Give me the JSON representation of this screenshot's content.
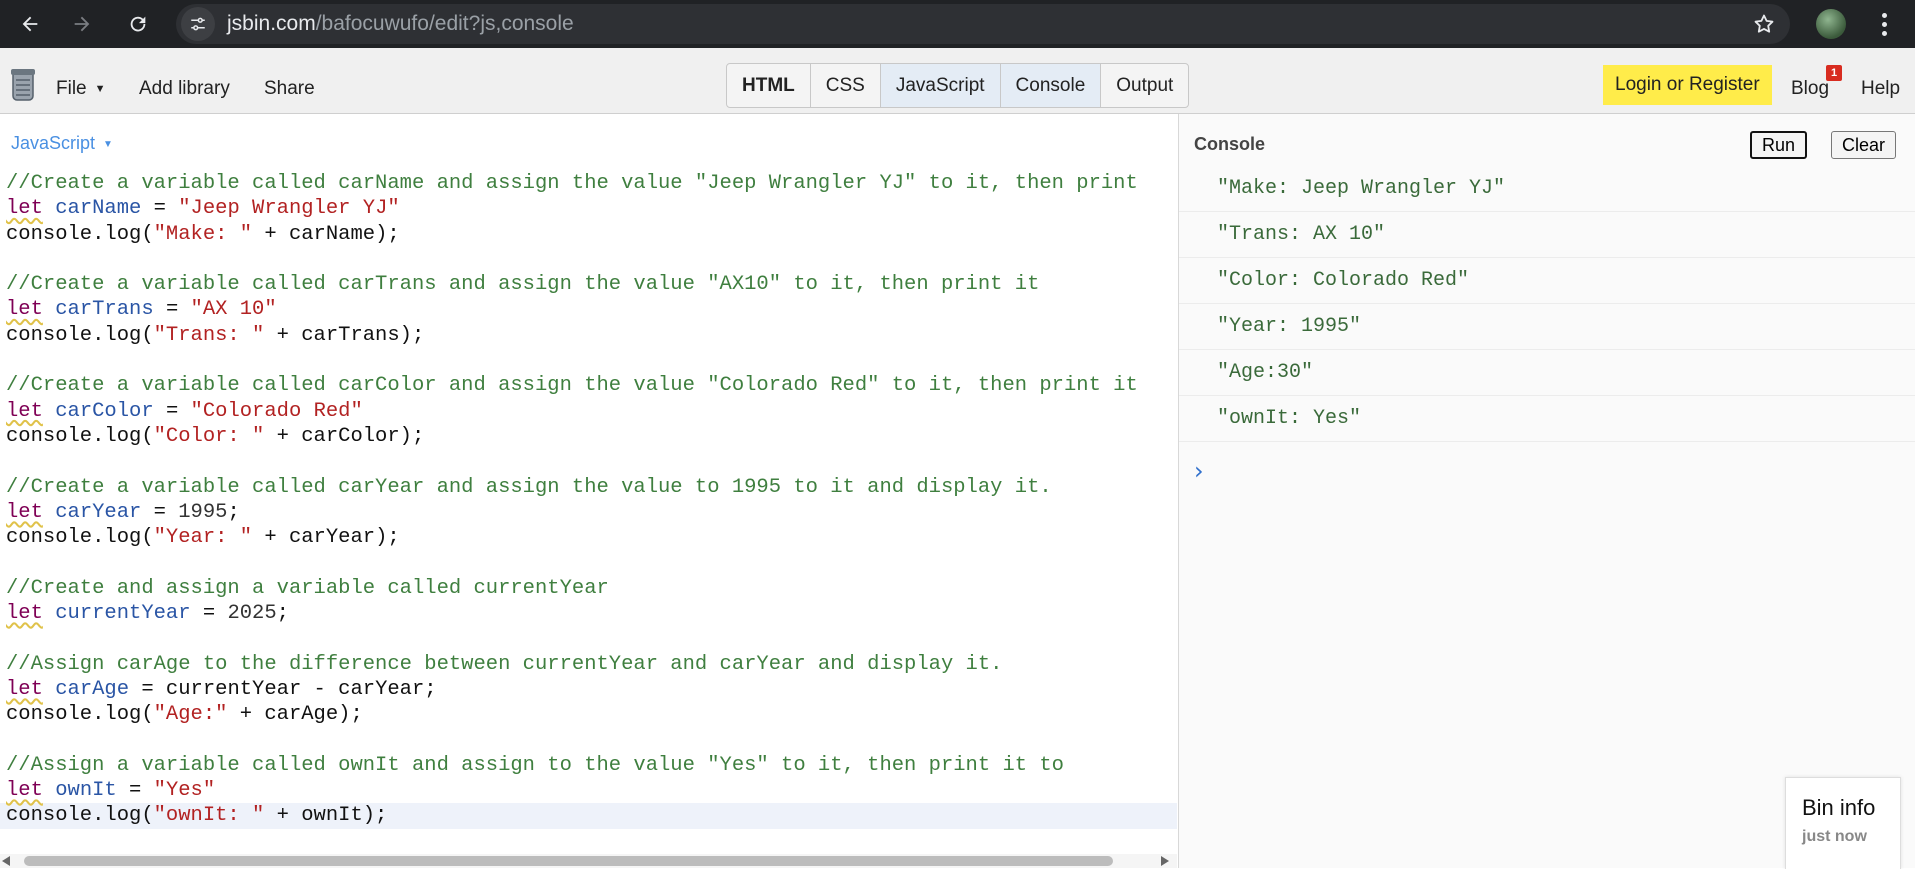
{
  "browser": {
    "url_host": "jsbin.com",
    "url_path": "/bafocuwufo/edit?js,console"
  },
  "toolbar": {
    "file_label": "File",
    "add_library_label": "Add library",
    "share_label": "Share",
    "panel_tabs": [
      {
        "label": "HTML",
        "active": false,
        "bold": true
      },
      {
        "label": "CSS",
        "active": false,
        "bold": false
      },
      {
        "label": "JavaScript",
        "active": true,
        "bold": false
      },
      {
        "label": "Console",
        "active": true,
        "bold": false
      },
      {
        "label": "Output",
        "active": false,
        "bold": false
      }
    ],
    "login_label": "Login or Register",
    "blog_label": "Blog",
    "blog_badge": "1",
    "help_label": "Help"
  },
  "editor": {
    "panel_label": "JavaScript",
    "lines": [
      [
        {
          "t": "c",
          "v": "//Create a variable called carName and assign the value \"Jeep Wrangler YJ\" to it, then print"
        }
      ],
      [
        {
          "t": "k",
          "v": "let"
        },
        {
          "t": "p",
          "v": " "
        },
        {
          "t": "v",
          "v": "carName"
        },
        {
          "t": "p",
          "v": " = "
        },
        {
          "t": "s",
          "v": "\"Jeep Wrangler YJ\""
        }
      ],
      [
        {
          "t": "p",
          "v": "console.log("
        },
        {
          "t": "s",
          "v": "\"Make: \""
        },
        {
          "t": "p",
          "v": " + carName);"
        }
      ],
      [],
      [
        {
          "t": "c",
          "v": "//Create a variable called carTrans and assign the value \"AX10\" to it, then print it"
        }
      ],
      [
        {
          "t": "k",
          "v": "let"
        },
        {
          "t": "p",
          "v": " "
        },
        {
          "t": "v",
          "v": "carTrans"
        },
        {
          "t": "p",
          "v": " = "
        },
        {
          "t": "s",
          "v": "\"AX 10\""
        }
      ],
      [
        {
          "t": "p",
          "v": "console.log("
        },
        {
          "t": "s",
          "v": "\"Trans: \""
        },
        {
          "t": "p",
          "v": " + carTrans);"
        }
      ],
      [],
      [
        {
          "t": "c",
          "v": "//Create a variable called carColor and assign the value \"Colorado Red\" to it, then print it"
        }
      ],
      [
        {
          "t": "k",
          "v": "let"
        },
        {
          "t": "p",
          "v": " "
        },
        {
          "t": "v",
          "v": "carColor"
        },
        {
          "t": "p",
          "v": " = "
        },
        {
          "t": "s",
          "v": "\"Colorado Red\""
        }
      ],
      [
        {
          "t": "p",
          "v": "console.log("
        },
        {
          "t": "s",
          "v": "\"Color: \""
        },
        {
          "t": "p",
          "v": " + carColor);"
        }
      ],
      [],
      [
        {
          "t": "c",
          "v": "//Create a variable called carYear and assign the value to 1995 to it and display it."
        }
      ],
      [
        {
          "t": "k",
          "v": "let"
        },
        {
          "t": "p",
          "v": " "
        },
        {
          "t": "v",
          "v": "carYear"
        },
        {
          "t": "p",
          "v": " = "
        },
        {
          "t": "n",
          "v": "1995"
        },
        {
          "t": "p",
          "v": ";"
        }
      ],
      [
        {
          "t": "p",
          "v": "console.log("
        },
        {
          "t": "s",
          "v": "\"Year: \""
        },
        {
          "t": "p",
          "v": " + carYear);"
        }
      ],
      [],
      [
        {
          "t": "c",
          "v": "//Create and assign a variable called currentYear"
        }
      ],
      [
        {
          "t": "k",
          "v": "let"
        },
        {
          "t": "p",
          "v": " "
        },
        {
          "t": "v",
          "v": "currentYear"
        },
        {
          "t": "p",
          "v": " = "
        },
        {
          "t": "n",
          "v": "2025"
        },
        {
          "t": "p",
          "v": ";"
        }
      ],
      [],
      [
        {
          "t": "c",
          "v": "//Assign carAge to the difference between currentYear and carYear and display it."
        }
      ],
      [
        {
          "t": "k",
          "v": "let"
        },
        {
          "t": "p",
          "v": " "
        },
        {
          "t": "v",
          "v": "carAge"
        },
        {
          "t": "p",
          "v": " = currentYear - carYear;"
        }
      ],
      [
        {
          "t": "p",
          "v": "console.log("
        },
        {
          "t": "s",
          "v": "\"Age:\""
        },
        {
          "t": "p",
          "v": " + carAge);"
        }
      ],
      [],
      [
        {
          "t": "c",
          "v": "//Assign a variable called ownIt and assign to the value \"Yes\" to it, then print it to"
        }
      ],
      [
        {
          "t": "k",
          "v": "let"
        },
        {
          "t": "p",
          "v": " "
        },
        {
          "t": "v",
          "v": "ownIt"
        },
        {
          "t": "p",
          "v": " = "
        },
        {
          "t": "s",
          "v": "\"Yes\""
        }
      ],
      [
        {
          "t": "p",
          "v": "console.log("
        },
        {
          "t": "s",
          "v": "\"ownIt: \""
        },
        {
          "t": "p",
          "v": " + ownIt);"
        }
      ]
    ],
    "active_line": 25
  },
  "console": {
    "label": "Console",
    "run_label": "Run",
    "clear_label": "Clear",
    "output": [
      "\"Make: Jeep Wrangler YJ\"",
      "\"Trans: AX 10\"",
      "\"Color: Colorado Red\"",
      "\"Year: 1995\"",
      "\"Age:30\"",
      "\"ownIt: Yes\""
    ],
    "prompt": "›"
  },
  "bin_info": {
    "title": "Bin info",
    "time": "just now"
  }
}
